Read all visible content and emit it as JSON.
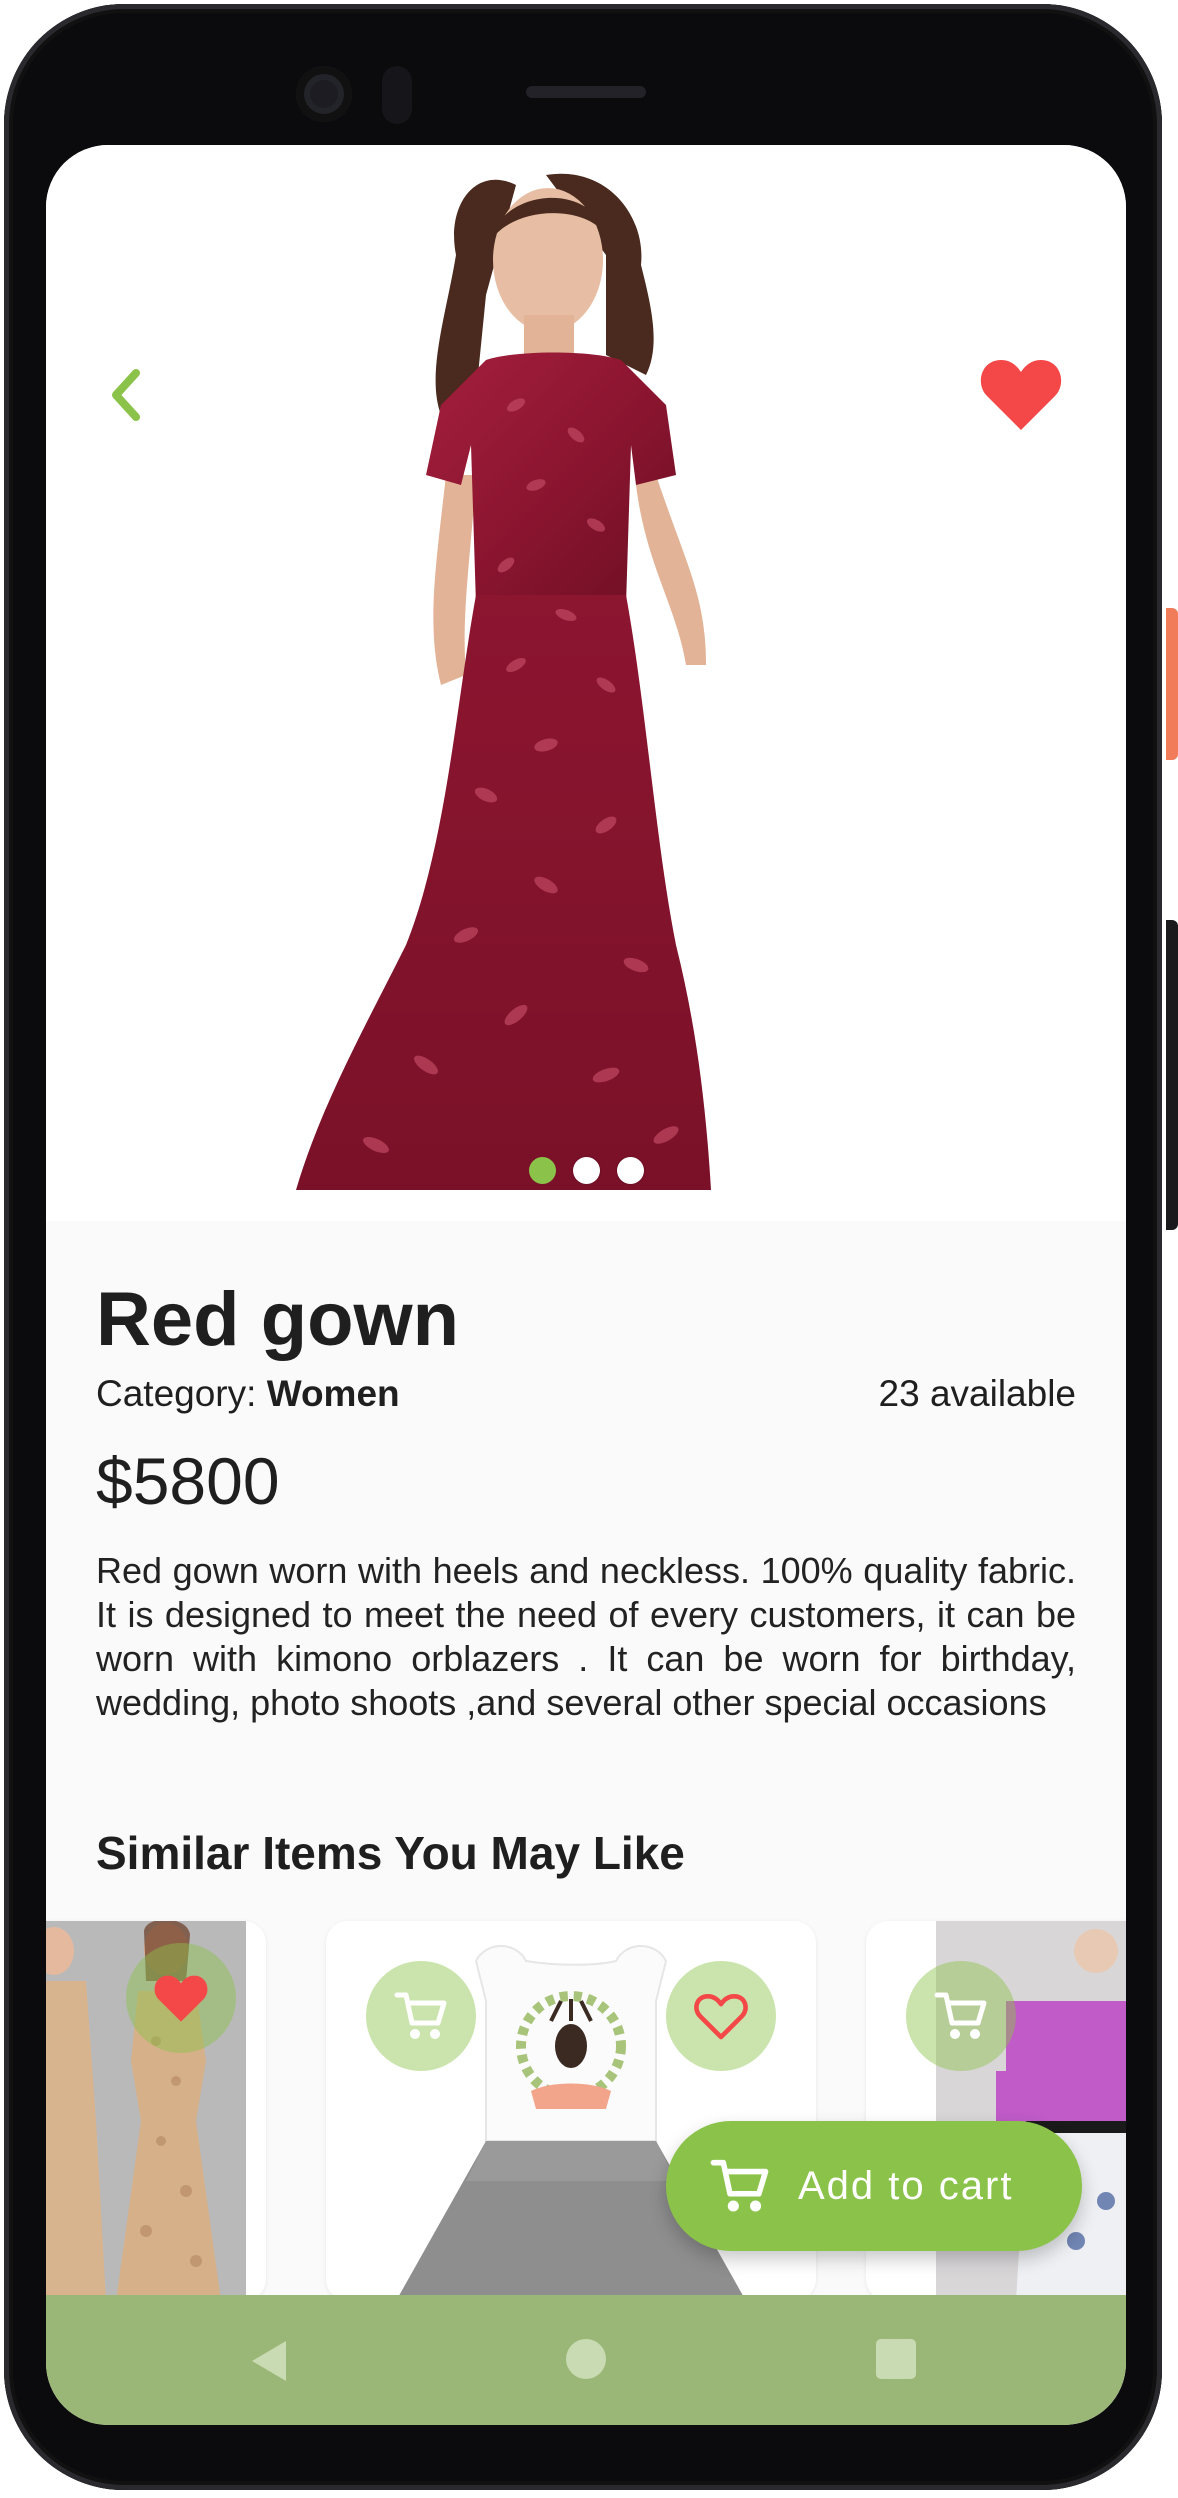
{
  "product": {
    "name": "Red gown",
    "category_label": "Category: ",
    "category_value": "Women",
    "availability": "23 available",
    "price": "$5800",
    "description": "Red gown worn with heels and neckless. 100% quality fabric. It is designed to meet the need of every customers, it can be worn with  kimono orblazers . It can be worn for birthday, wedding, photo shoots ,and  several other special occasions",
    "image_count": 3,
    "active_image_index": 0,
    "is_favorite": true
  },
  "sections": {
    "similar_title": "Similar Items You May Like"
  },
  "similar_items": [
    {
      "icon": "heart-filled-icon",
      "favorite": true
    },
    {
      "icon": "cart-icon",
      "favorite": false
    },
    {
      "icon": "cart-icon",
      "favorite": false
    }
  ],
  "actions": {
    "add_to_cart": "Add to cart"
  },
  "icons": {
    "back": "chevron-left-icon",
    "favorite": "heart-filled-icon",
    "cart": "cart-icon",
    "nav_back": "nav-back-icon",
    "nav_home": "nav-home-icon",
    "nav_recent": "nav-recent-icon"
  },
  "colors": {
    "accent": "#8bc34a",
    "favorite": "#f44848",
    "gown": "#8c1530",
    "navbar": "#9bb777",
    "text": "#1f1f1f"
  }
}
